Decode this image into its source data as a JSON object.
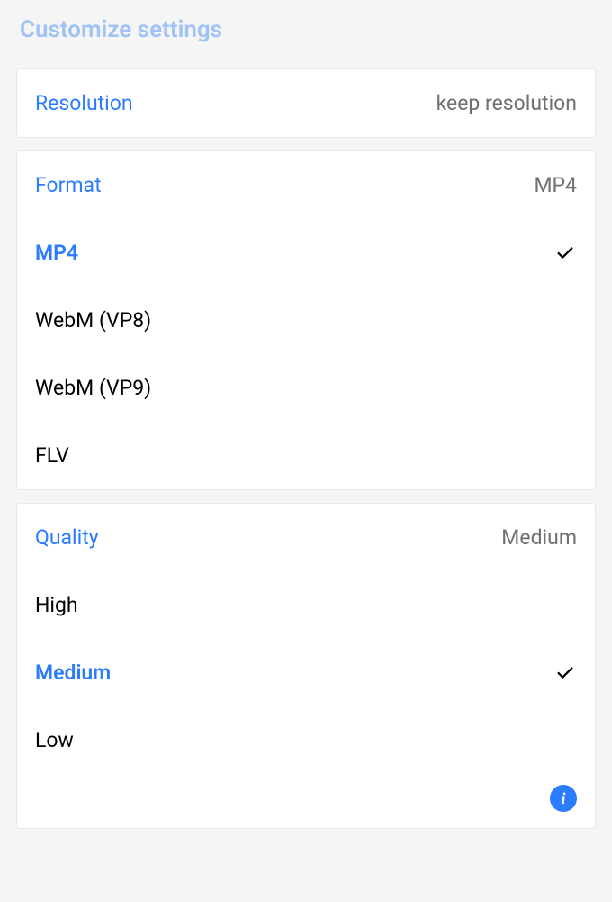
{
  "title": "Customize settings",
  "resolution": {
    "label": "Resolution",
    "value": "keep resolution"
  },
  "format": {
    "label": "Format",
    "value": "MP4",
    "options": [
      {
        "label": "MP4",
        "selected": true
      },
      {
        "label": "WebM (VP8)",
        "selected": false
      },
      {
        "label": "WebM (VP9)",
        "selected": false
      },
      {
        "label": "FLV",
        "selected": false
      }
    ]
  },
  "quality": {
    "label": "Quality",
    "value": "Medium",
    "options": [
      {
        "label": "High",
        "selected": false
      },
      {
        "label": "Medium",
        "selected": true
      },
      {
        "label": "Low",
        "selected": false
      }
    ]
  }
}
